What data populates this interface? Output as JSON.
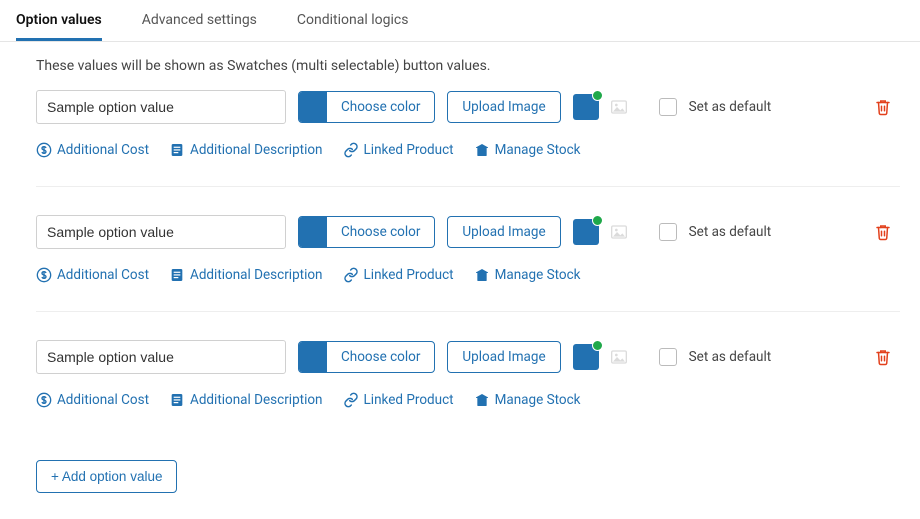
{
  "tabs": [
    {
      "label": "Option values",
      "active": true
    },
    {
      "label": "Advanced settings",
      "active": false
    },
    {
      "label": "Conditional logics",
      "active": false
    }
  ],
  "hint": "These values will be shown as Swatches (multi selectable) button values.",
  "choose_color_label": "Choose color",
  "upload_image_label": "Upload Image",
  "set_default_label": "Set as default",
  "sub": {
    "additional_cost": "Additional Cost",
    "additional_description": "Additional Description",
    "linked_product": "Linked Product",
    "manage_stock": "Manage Stock"
  },
  "rows": [
    {
      "value": "Sample option value",
      "color": "#2271b1",
      "default": false
    },
    {
      "value": "Sample option value",
      "color": "#2271b1",
      "default": false
    },
    {
      "value": "Sample option value",
      "color": "#2271b1",
      "default": false
    }
  ],
  "add_button_label": "+ Add option value"
}
